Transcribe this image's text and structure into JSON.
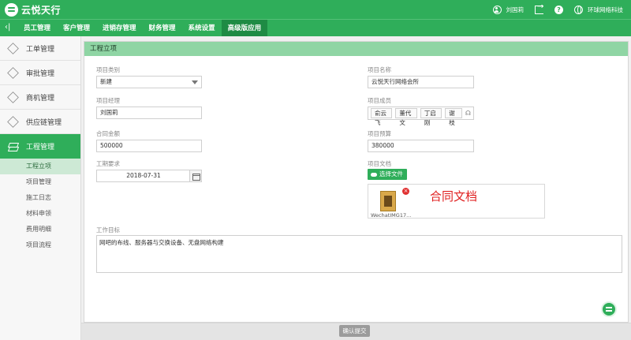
{
  "app": {
    "logo_text": "云悦天行",
    "user_name": "刘国莉",
    "org_name": "环球网络科技"
  },
  "nav": {
    "back_icon": "chevron-left-icon",
    "items": [
      {
        "label": "员工管理"
      },
      {
        "label": "客户管理"
      },
      {
        "label": "进销存管理"
      },
      {
        "label": "财务管理"
      },
      {
        "label": "系统设置"
      },
      {
        "label": "高级版应用",
        "active": true
      }
    ]
  },
  "sidebar": {
    "items": [
      {
        "label": "工单管理",
        "icon": "cube-icon"
      },
      {
        "label": "审批管理",
        "icon": "cube-icon"
      },
      {
        "label": "商机管理",
        "icon": "cube-icon"
      },
      {
        "label": "供应链管理",
        "icon": "cube-icon"
      },
      {
        "label": "工程管理",
        "icon": "layers-icon",
        "active": true
      }
    ],
    "subitems": [
      {
        "label": "工程立项",
        "active": true
      },
      {
        "label": "项目管理"
      },
      {
        "label": "施工日志"
      },
      {
        "label": "材料申领"
      },
      {
        "label": "费用明细"
      },
      {
        "label": "项目流程"
      }
    ]
  },
  "form": {
    "title": "工程立项",
    "project_type": {
      "label": "项目类别",
      "value": "新建"
    },
    "project_name": {
      "label": "项目名称",
      "value": "云悦天行网络会所"
    },
    "manager": {
      "label": "项目经理",
      "value": "刘国莉"
    },
    "members": {
      "label": "项目成员",
      "tags": [
        "俞云飞",
        "董代文",
        "丁启刚",
        "谢枝"
      ]
    },
    "contract_amount": {
      "label": "合同金额",
      "value": "500000"
    },
    "budget": {
      "label": "项目预算",
      "value": "380000"
    },
    "deadline": {
      "label": "工期要求",
      "value": "2018-07-31"
    },
    "documents": {
      "label": "项目文档",
      "upload_label": "选择文件",
      "file_name": "WechatIMG17...",
      "note": "合同文档"
    },
    "goal": {
      "label": "工作目标",
      "value": "网吧的布线、服务器与交换设备、无盘网络构建"
    },
    "submit_label": "确认提交"
  },
  "colors": {
    "brand_green": "#2fae5a",
    "header_green": "#8fd5a4",
    "active_sub": "#cde9d5",
    "alert_red": "#e02020"
  }
}
